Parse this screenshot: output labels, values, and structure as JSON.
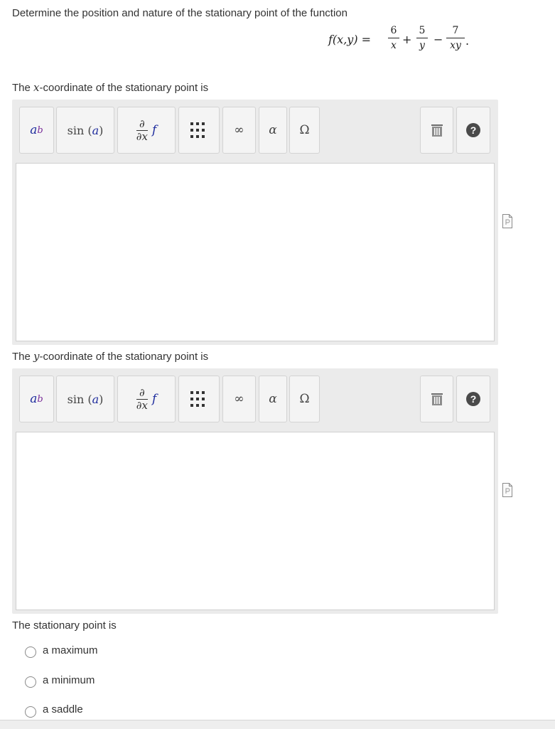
{
  "question": {
    "prompt": "Determine the position and nature of the stationary point of the function",
    "formula": {
      "lhs": "f(x,y) =",
      "term1": {
        "num": "6",
        "den": "x"
      },
      "op1": "+",
      "term2": {
        "num": "5",
        "den": "y"
      },
      "op2": "−",
      "term3": {
        "num": "7",
        "den": "xy"
      },
      "end": "."
    }
  },
  "part1": {
    "label_before": "The ",
    "label_var": "x",
    "label_after": "-coordinate of the stationary point is",
    "value": ""
  },
  "part2": {
    "label_before": "The ",
    "label_var": "y",
    "label_after": "-coordinate of the stationary point is",
    "value": ""
  },
  "toolbar": {
    "power_base": "a",
    "power_exp": "b",
    "sin_label": "sin",
    "sin_arg": "a",
    "deriv_num": "∂",
    "deriv_den": "∂x",
    "deriv_f": "f",
    "infinity": "∞",
    "alpha": "α",
    "omega": "Ω",
    "help": "?"
  },
  "part3": {
    "label": "The stationary point is",
    "options": [
      "a maximum",
      "a minimum",
      "a saddle"
    ]
  },
  "colors": {
    "toolbar_bg": "#ebebeb",
    "button_bg": "#f4f4f4",
    "accent_blue": "#1f2d9e",
    "accent_purple": "#7a2f9a"
  }
}
